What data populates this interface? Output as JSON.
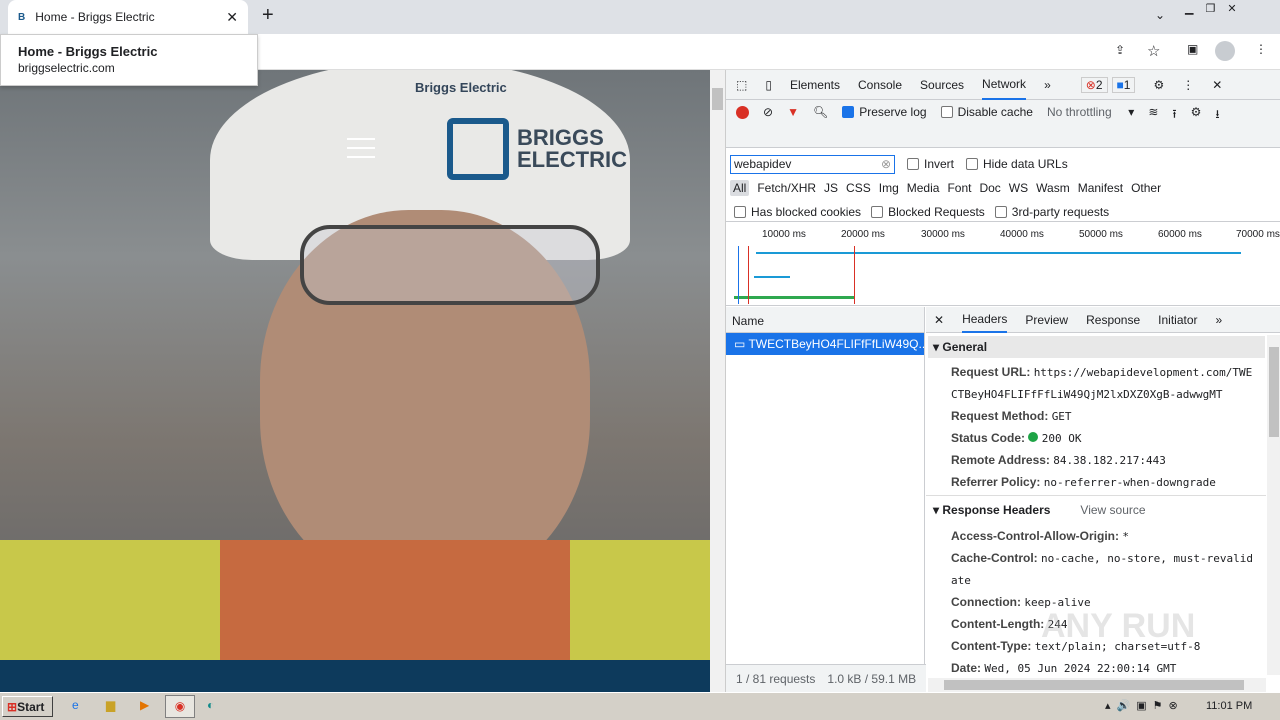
{
  "browser": {
    "tab_title": "Home - Briggs Electric",
    "new_tab": "+",
    "tooltip_title": "Home - Briggs Electric",
    "tooltip_url": "briggselectric.com"
  },
  "site": {
    "logo_line1": "BRIGGS",
    "logo_line2": "ELECTRIC",
    "helmet_text": "Briggs Electric"
  },
  "devtools": {
    "tabs": [
      "Elements",
      "Console",
      "Sources",
      "Network",
      "»"
    ],
    "active_tab": "Network",
    "errors": "2",
    "messages": "1",
    "preserve_log": "Preserve log",
    "disable_cache": "Disable cache",
    "throttling": "No throttling",
    "filter_value": "webapidev",
    "invert": "Invert",
    "hide_data_urls": "Hide data URLs",
    "types": [
      "All",
      "Fetch/XHR",
      "JS",
      "CSS",
      "Img",
      "Media",
      "Font",
      "Doc",
      "WS",
      "Wasm",
      "Manifest",
      "Other"
    ],
    "has_blocked_cookies": "Has blocked cookies",
    "blocked_requests": "Blocked Requests",
    "third_party": "3rd-party requests",
    "timeline_ticks": [
      "10000 ms",
      "20000 ms",
      "30000 ms",
      "40000 ms",
      "50000 ms",
      "60000 ms",
      "70000 ms"
    ],
    "name_header": "Name",
    "request_name": "TWECTBeyHO4FLIFfFfLiW49Q...",
    "status_bar": {
      "requests": "1 / 81 requests",
      "size": "1.0 kB / 59.1 MB"
    },
    "detail_tabs": [
      "Headers",
      "Preview",
      "Response",
      "Initiator",
      "»"
    ],
    "general_title": "General",
    "general": [
      {
        "k": "Request URL:",
        "v": "https://webapidevelopment.com/TWE"
      },
      {
        "k": "",
        "v": "CTBeyHO4FLIFfFfLiW49QjM2lxDXZ0XgB-adwwgMT"
      },
      {
        "k": "Request Method:",
        "v": "GET"
      },
      {
        "k": "Status Code:",
        "v": "200 OK"
      },
      {
        "k": "Remote Address:",
        "v": "84.38.182.217:443"
      },
      {
        "k": "Referrer Policy:",
        "v": "no-referrer-when-downgrade"
      }
    ],
    "response_title": "Response Headers",
    "view_source": "View source",
    "response": [
      {
        "k": "Access-Control-Allow-Origin:",
        "v": "*"
      },
      {
        "k": "Cache-Control:",
        "v": "no-cache, no-store, must-revalid"
      },
      {
        "k": "",
        "v": "ate"
      },
      {
        "k": "Connection:",
        "v": "keep-alive"
      },
      {
        "k": "Content-Length:",
        "v": "244"
      },
      {
        "k": "Content-Type:",
        "v": "text/plain; charset=utf-8"
      },
      {
        "k": "Date:",
        "v": "Wed, 05 Jun 2024 22:00:14 GMT"
      }
    ]
  },
  "taskbar": {
    "start": "Start",
    "time": "11:01 PM"
  },
  "watermark": "ANY RUN"
}
